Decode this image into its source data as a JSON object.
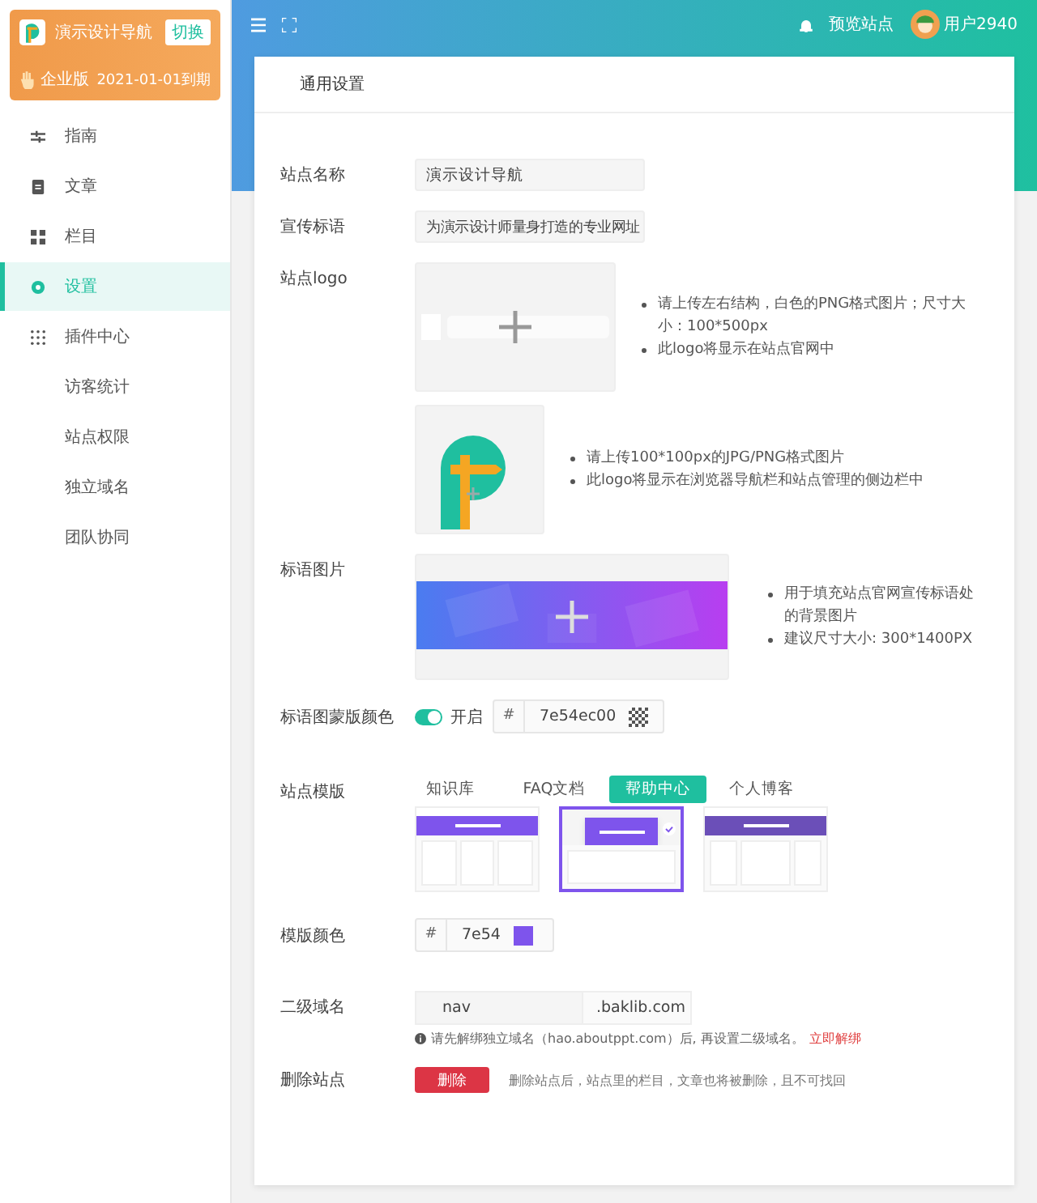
{
  "sidebar": {
    "site_name": "演示设计导航",
    "switch_button": "切换",
    "edition": "企业版",
    "expiry": "2021-01-01到期",
    "menu": [
      {
        "label": "指南",
        "selected": false
      },
      {
        "label": "文章",
        "selected": false
      },
      {
        "label": "栏目",
        "selected": false
      },
      {
        "label": "设置",
        "selected": true
      },
      {
        "label": "插件中心",
        "selected": false
      },
      {
        "label": "访客统计",
        "selected": false
      },
      {
        "label": "站点权限",
        "selected": false
      },
      {
        "label": "独立域名",
        "selected": false
      },
      {
        "label": "团队协同",
        "selected": false
      }
    ]
  },
  "header": {
    "preview_link": "预览站点",
    "user": "用户2940"
  },
  "card": {
    "title": "通用设置",
    "site_name": {
      "label": "站点名称",
      "value": "演示设计导航"
    },
    "slogan": {
      "label": "宣传标语",
      "value": "为演示设计师量身打造的专业网址"
    },
    "logo": {
      "label": "站点logo",
      "wide_tips": [
        "请上传左右结构，白色的PNG格式图片；尺寸大小：100*500px",
        "此logo将显示在站点官网中"
      ],
      "square_tips": [
        "请上传100*100px的JPG/PNG格式图片",
        "此logo将显示在浏览器导航栏和站点管理的侧边栏中"
      ]
    },
    "banner": {
      "label": "标语图片",
      "tips": [
        "用于填充站点官网宣传标语处的背景图片",
        "建议尺寸大小: 300*1400PX"
      ]
    },
    "mask": {
      "label": "标语图蒙版颜色",
      "on": true,
      "toggle_label": "开启",
      "prefix": "#",
      "value": "7e54ec00"
    },
    "template": {
      "label": "站点模版",
      "tabs": [
        {
          "label": "知识库",
          "selected": false
        },
        {
          "label": "FAQ文档",
          "selected": false
        },
        {
          "label": "帮助中心",
          "selected": true
        },
        {
          "label": "个人博客",
          "selected": false
        }
      ],
      "thumbnails": [
        {
          "kind": "columns",
          "selected": false
        },
        {
          "kind": "card",
          "selected": true
        },
        {
          "kind": "sidebar",
          "selected": false
        }
      ]
    },
    "template_color": {
      "label": "模版颜色",
      "prefix": "#",
      "value": "7e54"
    },
    "subdomain": {
      "label": "二级域名",
      "value": "nav",
      "suffix": ".baklib.com",
      "hint": "请先解绑独立域名（hao.aboutppt.com）后, 再设置二级域名。",
      "hint_link": "立即解绑"
    },
    "delete": {
      "label": "删除站点",
      "button": "删除",
      "note": "删除站点后，站点里的栏目，文章也将被删除，且不可找回"
    }
  }
}
